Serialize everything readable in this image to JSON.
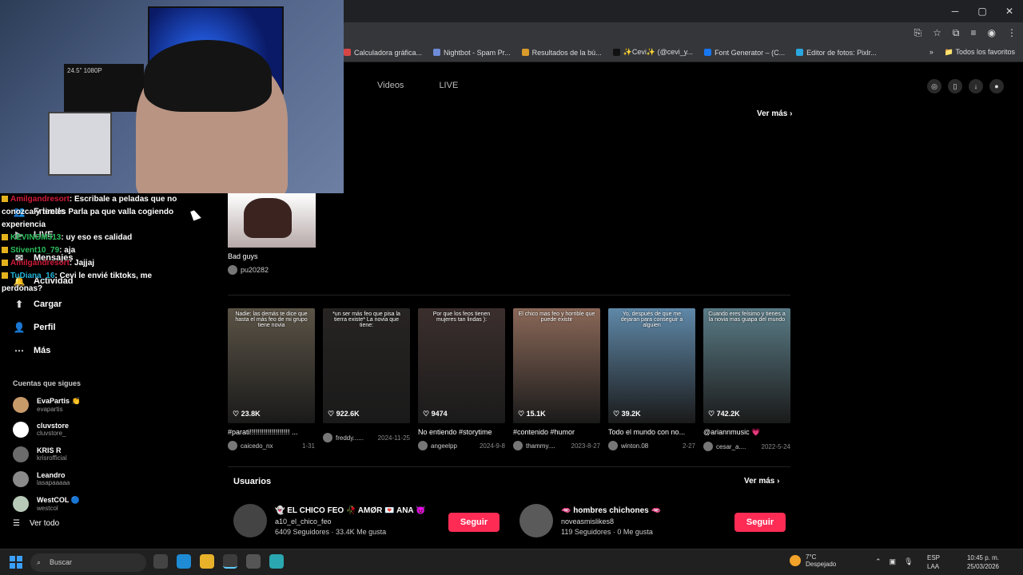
{
  "window": {
    "minimize": "─",
    "maximize": "▢",
    "close": "✕"
  },
  "bookmarks": [
    {
      "label": "Calculadora gráfica...",
      "color": "#d64545"
    },
    {
      "label": "Nightbot - Spam Pr...",
      "color": "#6d8bd6"
    },
    {
      "label": "Resultados de la bú...",
      "color": "#d99b2b"
    },
    {
      "label": "✨Cevi✨ (@cevi_y...",
      "color": "#111111"
    },
    {
      "label": "Font Generator – (C...",
      "color": "#1877f2"
    },
    {
      "label": "Editor de fotos: Pixlr...",
      "color": "#2aa7e0"
    }
  ],
  "bookmarks_more": "»",
  "bookmarks_folder": "Todos los favoritos",
  "tabs": [
    "Videos",
    "LIVE"
  ],
  "ver_mas_top": "Ver más",
  "cam": {
    "monitor_text": "24.5\" 1080P"
  },
  "chat": [
    {
      "user": "Amilgandresort",
      "user_class": "u-red",
      "text": ": Escribale a peladas que no conozca y tireles Parla pa que valla cogiendo experiencia"
    },
    {
      "user": "KEVINGM313",
      "user_class": "u-green",
      "text": ": uy eso es calidad"
    },
    {
      "user": "Stivent10_79",
      "user_class": "u-green",
      "text": ": aja"
    },
    {
      "user": "Amilgandresort",
      "user_class": "u-red",
      "text": ": Jajjaj"
    },
    {
      "user": "TuDiana_16",
      "user_class": "u-cyan",
      "text": ": Cevi le envié tiktoks, me perdonas?"
    }
  ],
  "sidebar": {
    "nav": [
      {
        "icon": "👥",
        "label": "Friends"
      },
      {
        "icon": "▶",
        "label": "LIVE"
      },
      {
        "icon": "✉",
        "label": "Mensajes"
      },
      {
        "icon": "🔔",
        "label": "Actividad"
      },
      {
        "icon": "⬆",
        "label": "Cargar"
      },
      {
        "icon": "👤",
        "label": "Perfil"
      },
      {
        "icon": "⋯",
        "label": "Más"
      }
    ],
    "following_title": "Cuentas que sigues",
    "accounts": [
      {
        "name": "EvaPartis 👏",
        "handle": "evapartis"
      },
      {
        "name": "cluvstore",
        "handle": "cluvstore_"
      },
      {
        "name": "KRIS R",
        "handle": "krisrofficial"
      },
      {
        "name": "Leandro",
        "handle": "lasapaaaaa"
      },
      {
        "name": "WestCOL 🔵",
        "handle": "westcol"
      }
    ],
    "see_all": "Ver todo"
  },
  "bad_guys": {
    "caption": "Bad guys",
    "author": "pu20282"
  },
  "videos": [
    {
      "overlay": "Nadie: las demás te dice que hasta el más feo de mi grupo tiene novia",
      "likes": "♡ 23.8K",
      "caption": "#parati!!!!!!!!!!!!!!!!!!!! ...",
      "author": "caicedo_nx",
      "date": "1-31",
      "bg": "#5b5346"
    },
    {
      "overlay": "*un ser más feo que pisa la tierra existe* La novia que tiene:",
      "likes": "♡ 922.6K",
      "caption": "",
      "author": "freddy......",
      "date": "2024-11-25",
      "bg": "#272422"
    },
    {
      "overlay": "Por que los feos tienen mujeres tan lindas ):",
      "likes": "♡ 9474",
      "caption": "No entiendo #storytime",
      "author": "angeelpp",
      "date": "2024-9-8",
      "bg": "#3b2f2d"
    },
    {
      "overlay": "El chico mas feo y horrible que puede existir",
      "likes": "♡ 15.1K",
      "caption": "#contenido #humor",
      "author": "thammy....",
      "date": "2023-8-27",
      "bg": "#8a6858"
    },
    {
      "overlay": "Yo, después de que me dejaran para conseguir a alguien",
      "likes": "♡ 39.2K",
      "caption": "Todo el mundo con no...",
      "author": "winton.08",
      "date": "2-27",
      "bg": "#5f88a8"
    },
    {
      "overlay": "Cuando eres feísimo y tienes a la novia mas guapa del mundo",
      "likes": "♡ 742.2K",
      "caption": "@ariannmusic 💗",
      "author": "cesar_a....",
      "date": "2022-5-24",
      "bg": "#5a7b86"
    }
  ],
  "users_title": "Usuarios",
  "users_more": "Ver más",
  "users": [
    {
      "name": "👻 EL CHICO FEO 🥀 AMØR 💌 ANA 😈",
      "handle": "a10_el_chico_feo",
      "stats": "6409 Seguidores · 33.4K Me gusta",
      "follow": "Seguir"
    },
    {
      "name": "🫦 hombres chichones 🫦",
      "handle": "noveasmislikes8",
      "stats": "119 Seguidores · 0 Me gusta",
      "follow": "Seguir"
    }
  ],
  "taskbar": {
    "search": "Buscar",
    "weather_temp": "7°C",
    "weather_text": "Despejado",
    "lang1": "ESP",
    "lang2": "LAA",
    "time": "10:45 p. m.",
    "date": "25/03/2026"
  }
}
